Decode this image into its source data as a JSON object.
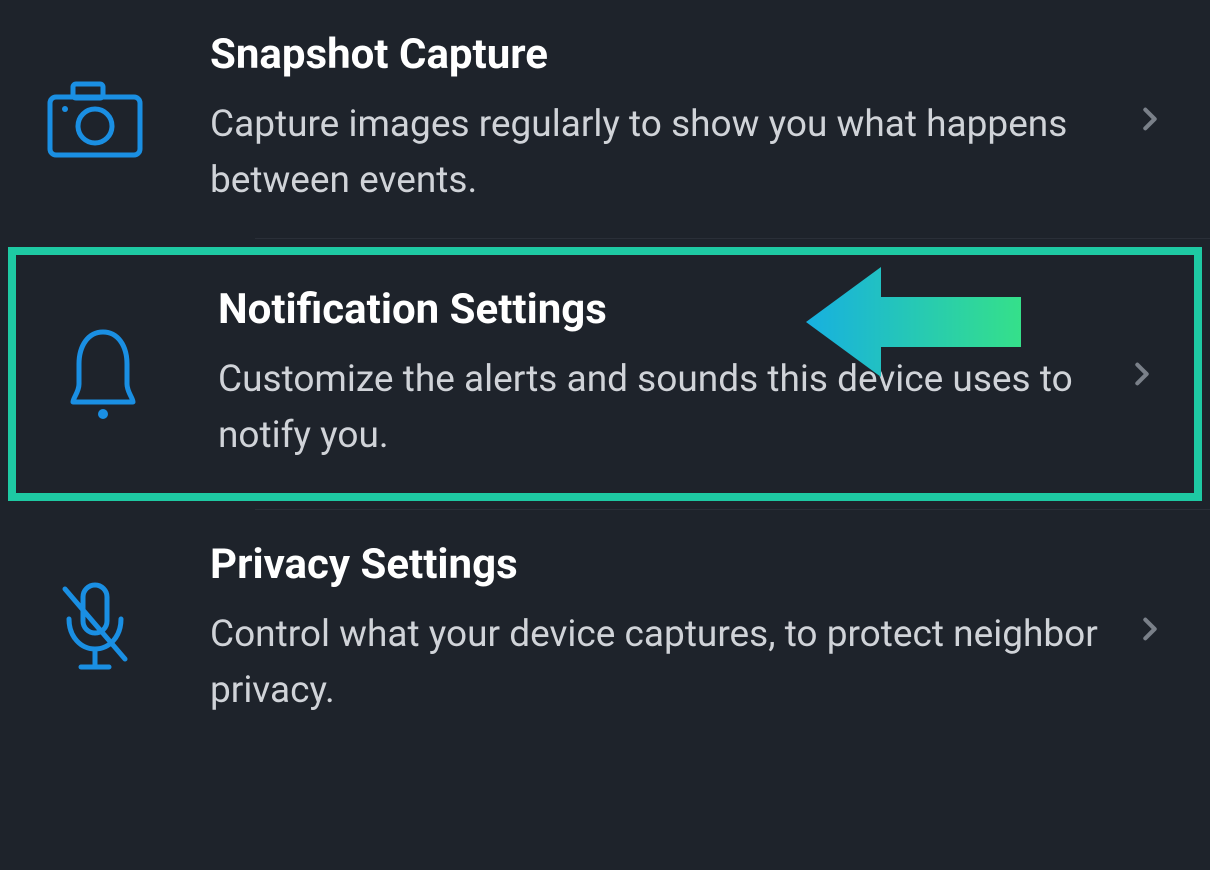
{
  "settings": [
    {
      "title": "Snapshot Capture",
      "description": "Capture images regularly to show you what happens between events.",
      "icon": "camera-icon",
      "highlighted": false
    },
    {
      "title": "Notification Settings",
      "description": "Customize the alerts and sounds this device uses to notify you.",
      "icon": "bell-icon",
      "highlighted": true
    },
    {
      "title": "Privacy Settings",
      "description": "Control what your device captures, to protect neighbor privacy.",
      "icon": "mic-off-icon",
      "highlighted": false
    }
  ]
}
